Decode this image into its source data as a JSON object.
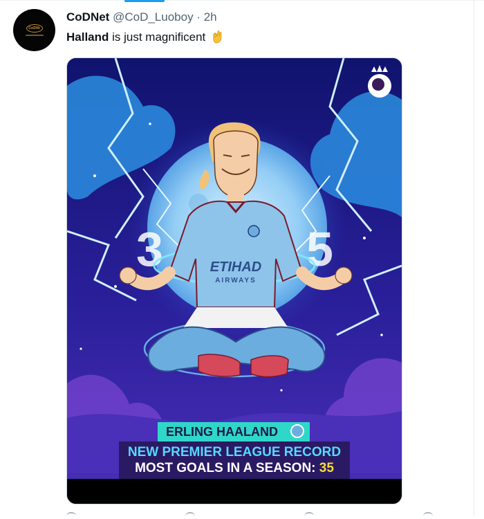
{
  "tweet": {
    "author_name": "CoDNet",
    "author_handle": "@CoD_Luoboy",
    "separator": "·",
    "time": "2h",
    "text_bold": "Halland",
    "text_rest": " is just magnificent",
    "emoji": "ok-hand-emoji"
  },
  "avatar": {
    "logo_text": "CoDNt"
  },
  "media": {
    "poster_name": "ERLING HAALAND",
    "headline_line1": "NEW PREMIER LEAGUE RECORD",
    "headline_line2_prefix": "MOST GOALS IN A SEASON: ",
    "headline_number": "35",
    "shirt_sponsor_line1": "ETIHAD",
    "shirt_sponsor_line2": "AIRWAYS",
    "moon_numbers_left": "3",
    "moon_numbers_right": "5"
  },
  "colors": {
    "accent": "#1d9bf0",
    "name_banner": "#2fd7c9",
    "record_banner": "#2a1a63",
    "record_text": "#56d9ff",
    "record_number": "#f6dc3a"
  }
}
